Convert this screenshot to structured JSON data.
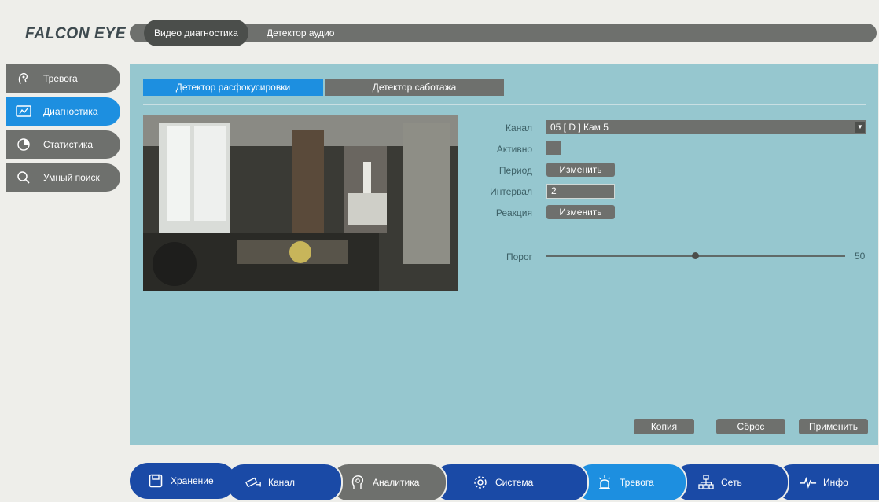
{
  "brand": {
    "logo_text": "FALCON EYE"
  },
  "top_tabs": [
    {
      "label": "Видео диагностика",
      "active": true
    },
    {
      "label": "Детектор аудио",
      "active": false
    }
  ],
  "sidebar": {
    "items": [
      {
        "label": "Тревога",
        "icon": "alarm-hand-icon",
        "active": false
      },
      {
        "label": "Диагностика",
        "icon": "diagnostics-icon",
        "active": true
      },
      {
        "label": "Статистика",
        "icon": "pie-chart-icon",
        "active": false
      },
      {
        "label": "Умный поиск",
        "icon": "search-icon",
        "active": false
      }
    ]
  },
  "sub_tabs": [
    {
      "label": "Детектор расфокусировки",
      "active": true
    },
    {
      "label": "Детектор саботажа",
      "active": false
    }
  ],
  "settings": {
    "channel_label": "Канал",
    "channel_value": "05 [ D ] Кам 5",
    "active_label": "Активно",
    "active_checked": false,
    "period_label": "Период",
    "period_button": "Изменить",
    "interval_label": "Интервал",
    "interval_value": "2",
    "reaction_label": "Реакция",
    "reaction_button": "Изменить",
    "threshold_label": "Порог",
    "threshold_value": "50"
  },
  "actions": {
    "copy": "Копия",
    "reset": "Сброс",
    "apply": "Применить"
  },
  "bottom_nav": [
    {
      "label": "Хранение",
      "icon": "save-icon",
      "color": "#1a4aa6"
    },
    {
      "label": "Канал",
      "icon": "camera-icon",
      "color": "#1a4aa6"
    },
    {
      "label": "Аналитика",
      "icon": "analytics-head-icon",
      "color": "#6e706d"
    },
    {
      "label": "Система",
      "icon": "gear-icon",
      "color": "#1a4aa6"
    },
    {
      "label": "Тревога",
      "icon": "alarm-icon",
      "color": "#1d8fe0"
    },
    {
      "label": "Сеть",
      "icon": "network-icon",
      "color": "#1a4aa6"
    },
    {
      "label": "Инфо",
      "icon": "pulse-icon",
      "color": "#1a4aa6"
    }
  ],
  "colors": {
    "accent": "#1d8fe0",
    "panel": "#96c7cf",
    "grey": "#6e706d",
    "navy": "#1a4aa6"
  }
}
